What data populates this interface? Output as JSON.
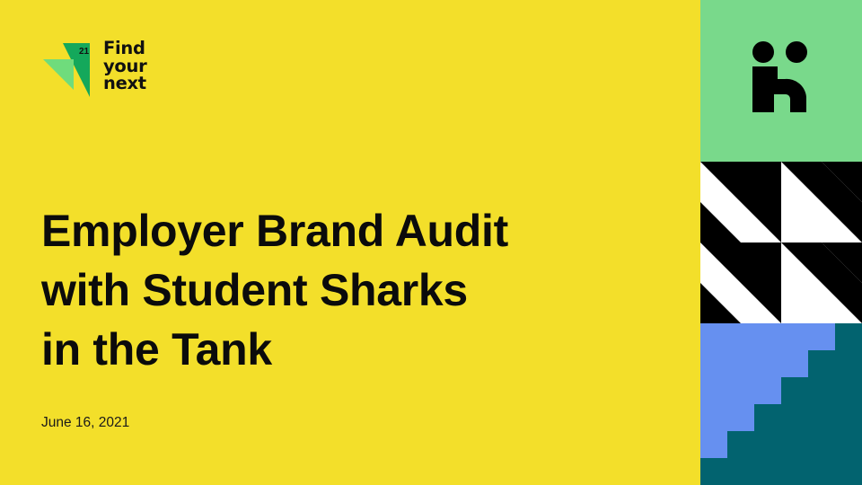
{
  "brand": {
    "logo_number": "21",
    "logo_lines": [
      "Find",
      "your",
      "next"
    ],
    "logo_mark_colors": {
      "dark": "#14a85b",
      "light": "#6fdc7c"
    }
  },
  "slide": {
    "title_lines": [
      "Employer Brand Audit",
      "with Student Sharks",
      "in the Tank"
    ],
    "date": "June 16, 2021"
  },
  "decor": {
    "icon": "handshake-logo-icon",
    "colors": {
      "background": "#f3df2a",
      "green": "#79d98b",
      "black": "#000000",
      "white": "#ffffff",
      "blue": "#6690f0",
      "teal": "#02636f"
    }
  }
}
